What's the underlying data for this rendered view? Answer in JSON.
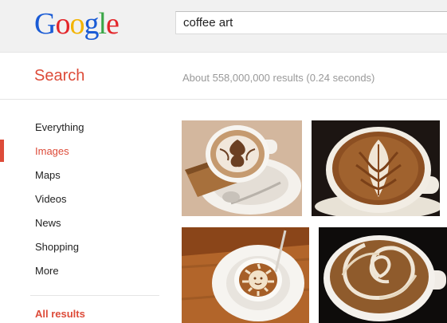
{
  "logo": {
    "text": "Google",
    "colors": [
      "#1a5bd5",
      "#e3262b",
      "#f3b400",
      "#1a5bd5",
      "#3aa647",
      "#e3262b"
    ]
  },
  "search": {
    "query": "coffee art"
  },
  "subheader": {
    "label": "Search",
    "result_stats": "About 558,000,000 results (0.24 seconds)"
  },
  "nav": {
    "items": [
      {
        "label": "Everything"
      },
      {
        "label": "Images"
      },
      {
        "label": "Maps"
      },
      {
        "label": "Videos"
      },
      {
        "label": "News"
      },
      {
        "label": "Shopping"
      },
      {
        "label": "More"
      }
    ],
    "selected": "Images",
    "all_results": "All results"
  },
  "theme": {
    "accent": "#dd4b39",
    "topbar_bg": "#f1f1f1",
    "stats_color": "#999999"
  },
  "images": [
    {
      "subject": "latte art flower with biscuit and spoon"
    },
    {
      "subject": "latte art rosetta on dark background"
    },
    {
      "subject": "latte art sun face on wooden table"
    },
    {
      "subject": "latte art spiral swirl on dark background"
    }
  ]
}
